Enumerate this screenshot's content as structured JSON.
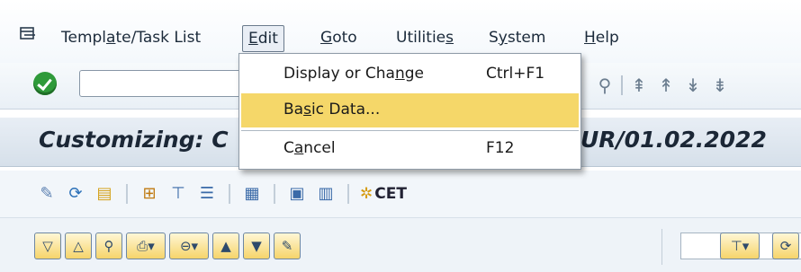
{
  "menubar": {
    "system_icon": "menu-corner-icon",
    "items": [
      {
        "label_pre": "Templ",
        "label_u": "a",
        "label_post": "te/Task List"
      },
      {
        "label_pre": "",
        "label_u": "E",
        "label_post": "dit"
      },
      {
        "label_pre": "",
        "label_u": "G",
        "label_post": "oto"
      },
      {
        "label_pre": "Utilitie",
        "label_u": "s",
        "label_post": ""
      },
      {
        "label_pre": "S",
        "label_u": "y",
        "label_post": "stem"
      },
      {
        "label_pre": "",
        "label_u": "H",
        "label_post": "elp"
      }
    ]
  },
  "dropdown": {
    "items": [
      {
        "label_pre": "Display or Cha",
        "label_u": "n",
        "label_post": "ge",
        "shortcut": "Ctrl+F1"
      },
      {
        "label_pre": "Ba",
        "label_u": "s",
        "label_post": "ic Data...",
        "shortcut": ""
      },
      {
        "label_pre": "C",
        "label_u": "a",
        "label_post": "ncel",
        "shortcut": "F12"
      }
    ]
  },
  "titlebar": {
    "title_left": "Customizing: C",
    "title_right": "UR/01.02.2022"
  },
  "appbar": {
    "cet_label": "CET"
  },
  "colors": {
    "highlight": "#f5d769",
    "ok_green": "#2f9a3a",
    "title_bg": "#dbe4ee"
  }
}
